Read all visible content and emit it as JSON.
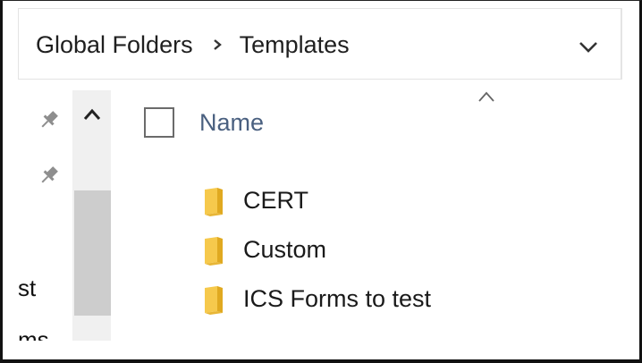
{
  "breadcrumb": {
    "items": [
      "Global Folders",
      "Templates"
    ]
  },
  "nav": {
    "partial_items": [
      "st",
      "ms"
    ]
  },
  "columns": {
    "name": "Name"
  },
  "files": [
    {
      "name": "CERT",
      "icon": "folder-icon"
    },
    {
      "name": "Custom",
      "icon": "folder-icon"
    },
    {
      "name": "ICS Forms to test",
      "icon": "folder-icon"
    }
  ],
  "colors": {
    "folder": "#f6c94c",
    "folder_dark": "#e0a920",
    "column_header": "#4a6080",
    "scroll_thumb": "#cdcdcd"
  }
}
